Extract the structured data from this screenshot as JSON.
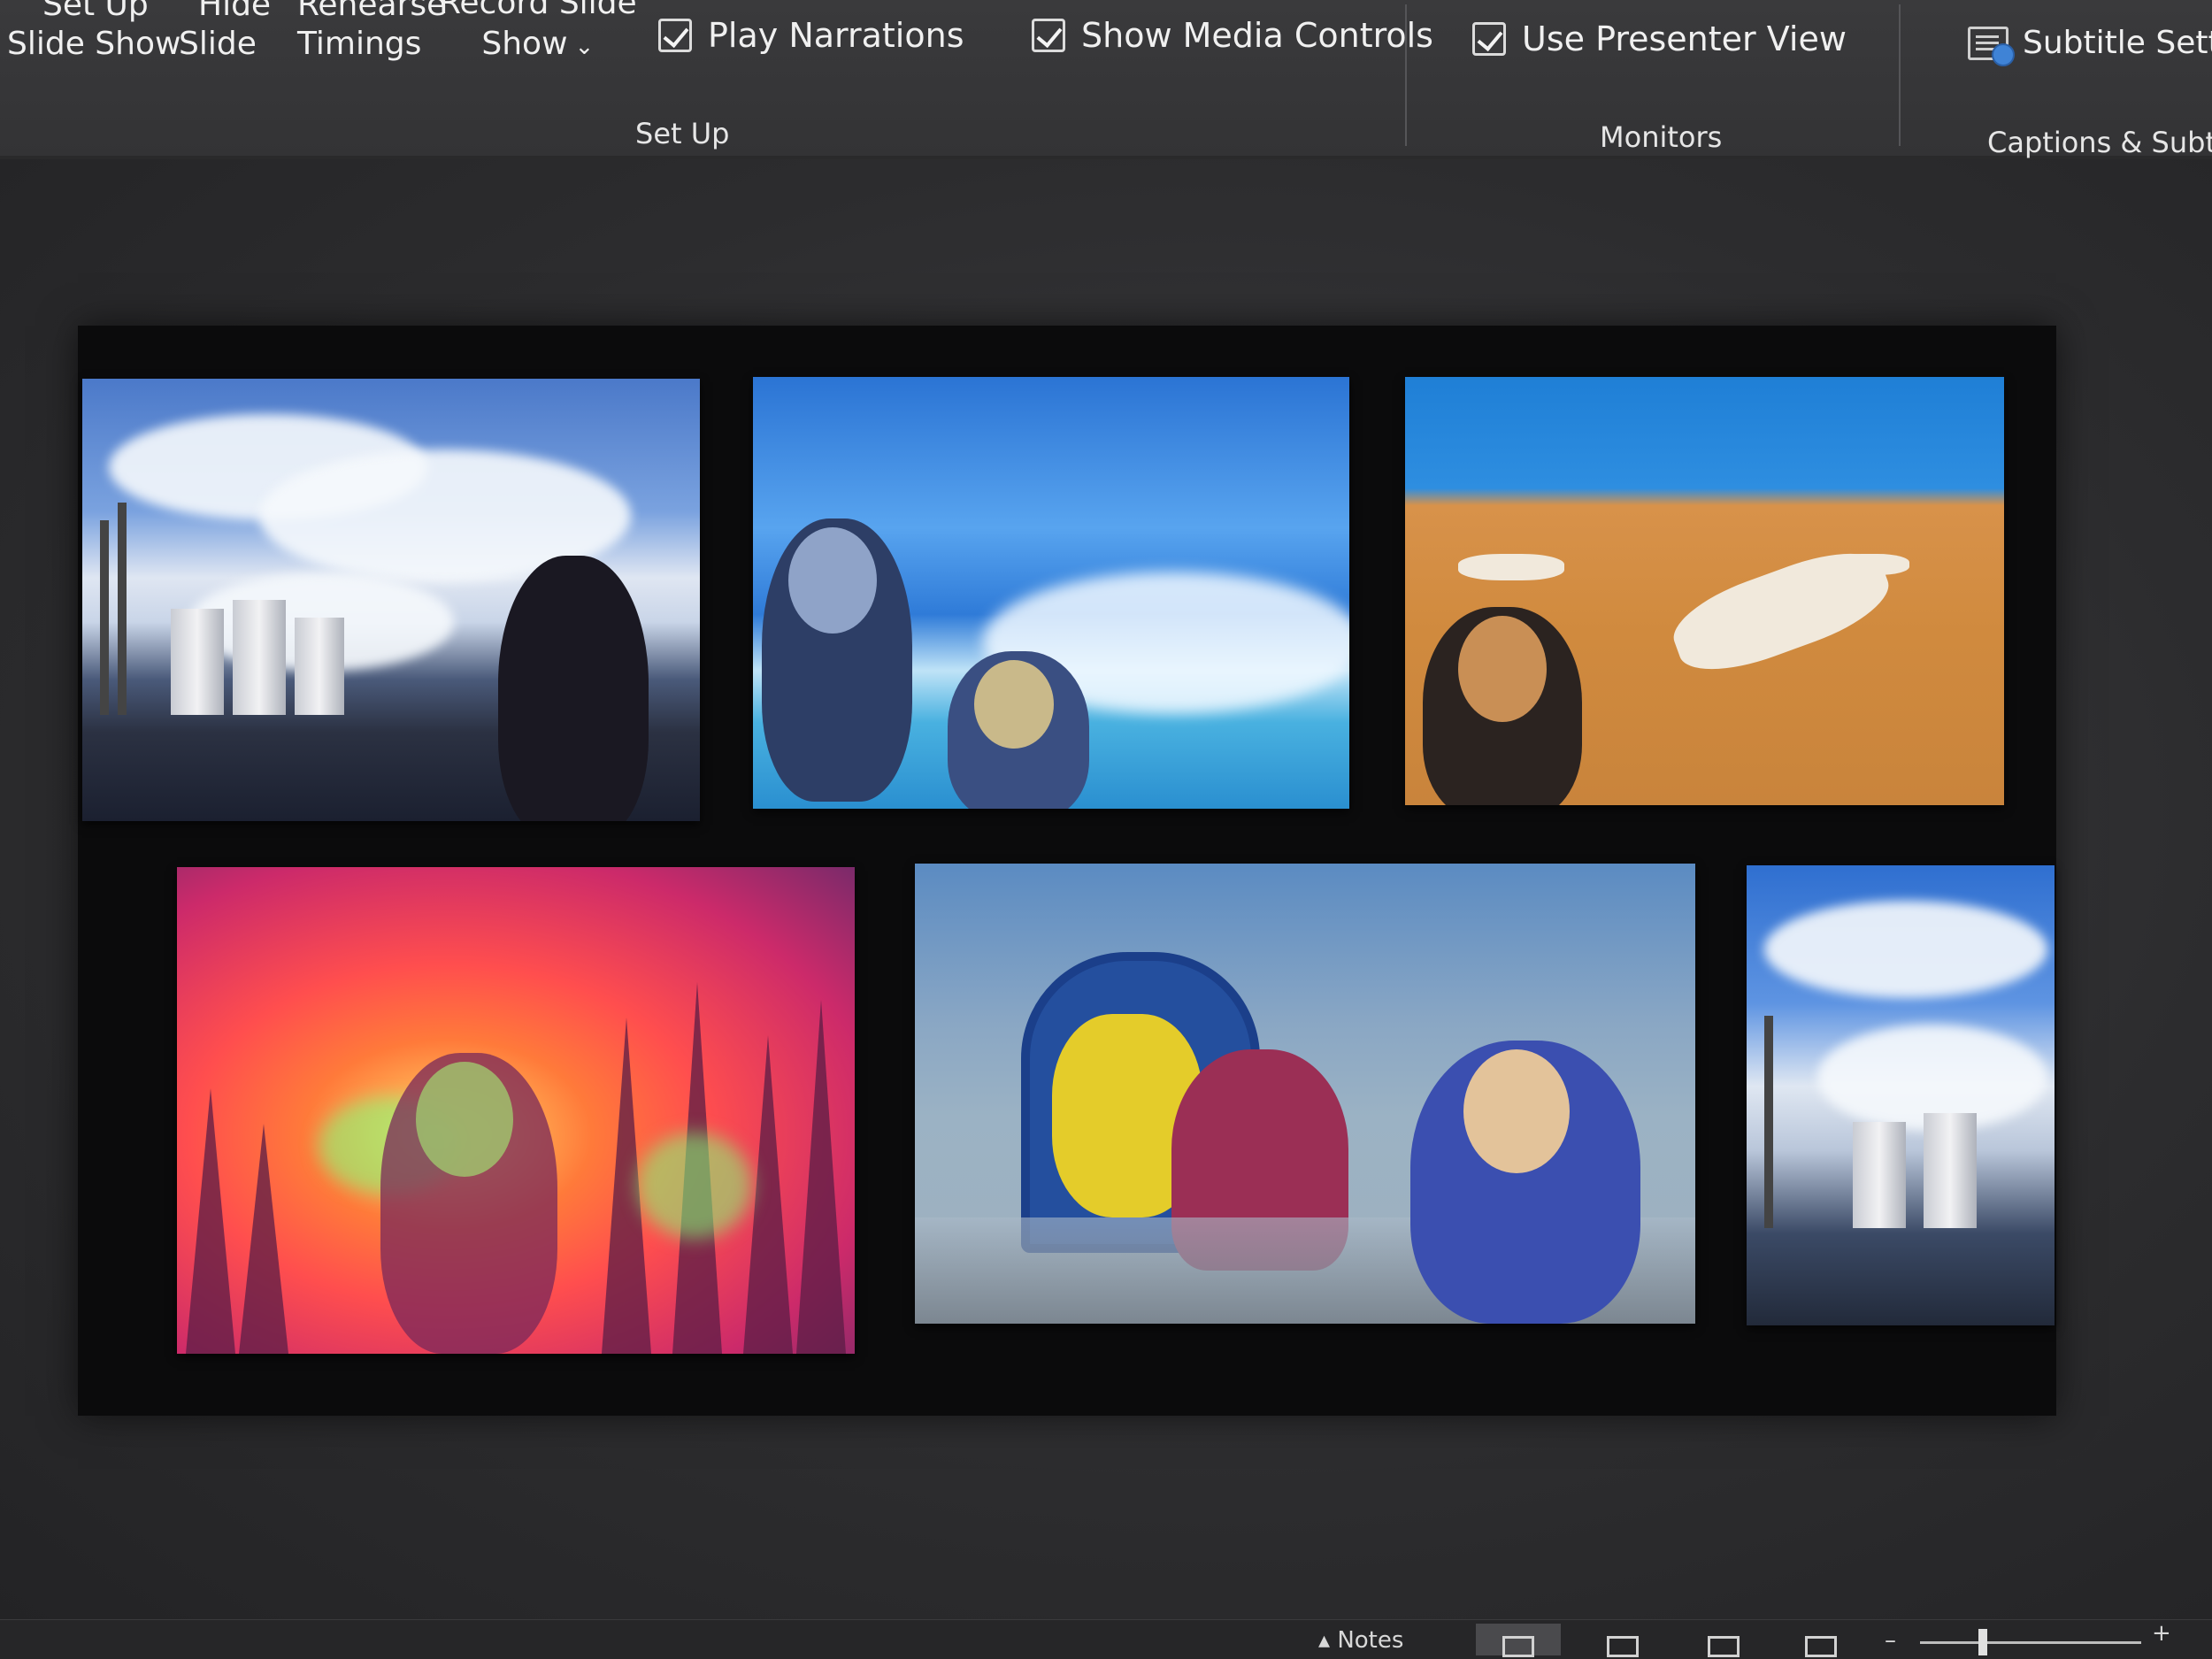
{
  "ribbon": {
    "setup_slideshow_l1": "Set Up",
    "setup_slideshow_l2": "Slide Show",
    "hide_slide_l1": "Hide",
    "hide_slide_l2": "Slide",
    "rehearse_l1": "Rehearse",
    "rehearse_l2": "Timings",
    "record_l1": "Record Slide",
    "record_l2": "Show",
    "play_narrations": "Play Narrations",
    "show_media_controls": "Show Media Controls",
    "use_presenter_view": "Use Presenter View",
    "subtitle_settings": "Subtitle Setting",
    "groups": {
      "setup": "Set Up",
      "monitors": "Monitors",
      "captions": "Captions & Subtitles"
    },
    "checkboxes": {
      "play_narrations": true,
      "show_media_controls": true,
      "use_presenter_view": true
    }
  },
  "statusbar": {
    "notes": "Notes",
    "zoom_minus": "–",
    "zoom_plus": "+"
  },
  "colors": {
    "ribbon_bg": "#3a3a3c",
    "workspace_bg": "#2c2c2e",
    "slide_bg": "#0b0b0c",
    "accent": "#3f83d6"
  }
}
